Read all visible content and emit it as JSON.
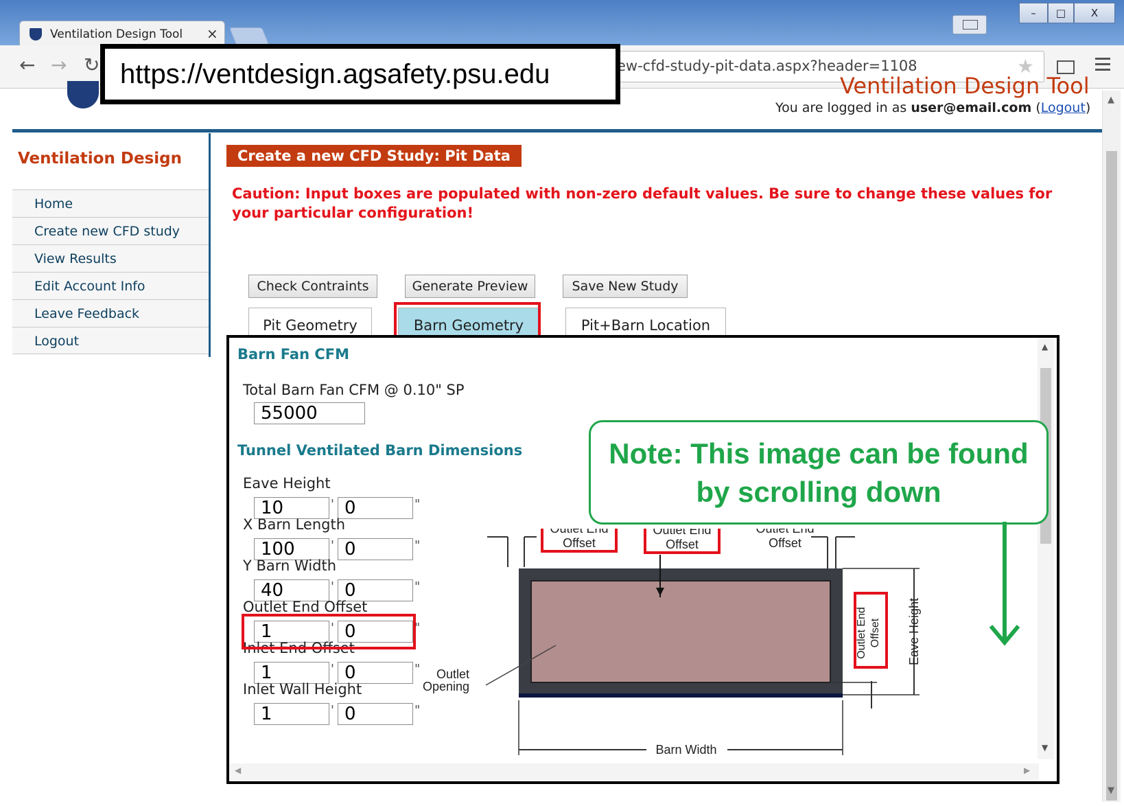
{
  "browser": {
    "tab_title": "Ventilation Design Tool",
    "tab_close": "×",
    "url_visible": "ew-cfd-study-pit-data.aspx?header=1108",
    "window_controls": [
      "–",
      "□",
      "X"
    ]
  },
  "callout": {
    "url": "https://ventdesign.agsafety.psu.edu"
  },
  "header": {
    "site_title": "Ventilation Design Tool",
    "logged_in_prefix": "You are logged in as ",
    "user": "user@email.com",
    "logout_open": "(",
    "logout": "Logout",
    "logout_close": ")"
  },
  "sidebar": {
    "heading": "Ventilation Design",
    "items": [
      {
        "label": "Home"
      },
      {
        "label": "Create new CFD study"
      },
      {
        "label": "View Results"
      },
      {
        "label": "Edit Account Info"
      },
      {
        "label": "Leave Feedback"
      },
      {
        "label": "Logout"
      }
    ]
  },
  "main": {
    "heading": "Create a new CFD Study: Pit Data",
    "caution": "Caution: Input boxes are populated with non-zero default values. Be sure to change these values for your particular configuration!",
    "buttons": {
      "check": "Check Contraints",
      "preview": "Generate Preview",
      "save": "Save New Study"
    },
    "tabs": [
      {
        "label": "Pit Geometry"
      },
      {
        "label": "Barn Geometry",
        "active": true
      },
      {
        "label": "Pit+Barn Location"
      }
    ]
  },
  "form": {
    "fan_section": "Barn Fan CFM",
    "total_cfm_label": "Total Barn Fan CFM @ 0.10\" SP",
    "total_cfm_value": "55000",
    "dims_section": "Tunnel Ventilated Barn Dimensions",
    "feet_mark": "'",
    "inch_mark": "\"",
    "fields": [
      {
        "label": "Eave Height",
        "feet": "10",
        "inches": "0"
      },
      {
        "label": "X Barn Length",
        "feet": "100",
        "inches": "0"
      },
      {
        "label": "Y Barn Width",
        "feet": "40",
        "inches": "0"
      },
      {
        "label": "Outlet End Offset",
        "feet": "1",
        "inches": "0"
      },
      {
        "label": "Inlet End Offset",
        "feet": "1",
        "inches": "0"
      },
      {
        "label": "Inlet Wall Height",
        "feet": "1",
        "inches": "0"
      }
    ]
  },
  "diagram": {
    "outlet_end": "Outlet End",
    "offset": "Offset",
    "outlet": "Outlet",
    "opening": "Opening",
    "eave_height": "Eave Height",
    "barn_width": "Barn Width"
  },
  "note": {
    "line1": "Note:  This image can be found",
    "line2": "by scrolling down"
  },
  "colors": {
    "accent_red": "#c33b10",
    "caution_red": "#e4141c",
    "section_teal": "#1a7a8c",
    "active_tab": "#a9dbe9",
    "note_green": "#1fa64a",
    "highlight_red": "#e3111c"
  }
}
